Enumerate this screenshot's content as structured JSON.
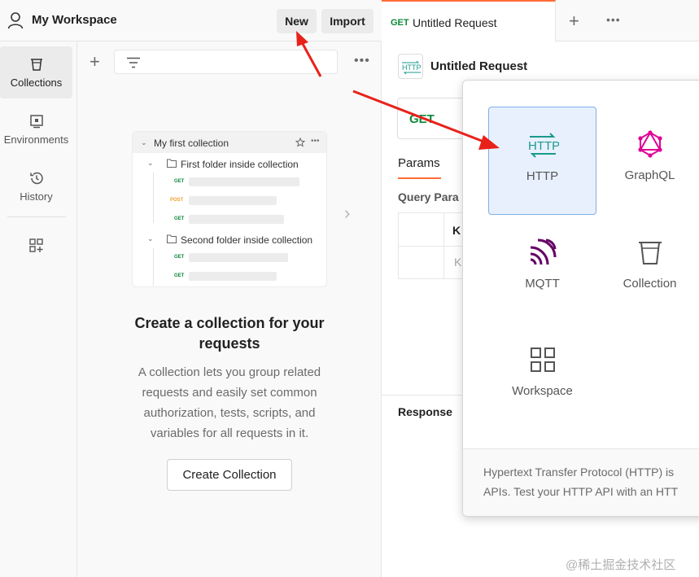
{
  "workspace": {
    "title": "My Workspace",
    "new_label": "New",
    "import_label": "Import"
  },
  "leftnav": {
    "items": [
      {
        "label": "Collections",
        "icon": "trash-bin-icon"
      },
      {
        "label": "Environments",
        "icon": "environment-icon"
      },
      {
        "label": "History",
        "icon": "history-icon"
      }
    ]
  },
  "illustration": {
    "collection_title": "My first collection",
    "folder1": "First folder inside collection",
    "folder2": "Second folder inside collection",
    "methods": [
      "GET",
      "POST",
      "GET",
      "GET",
      "GET"
    ]
  },
  "empty_state": {
    "title": "Create a collection for your requests",
    "description": "A collection lets you group related requests and easily set common authorization, tests, scripts, and variables for all requests in it.",
    "button": "Create Collection"
  },
  "tab": {
    "method": "GET",
    "name": "Untitled Request"
  },
  "request": {
    "title": "Untitled Request",
    "method": "GET",
    "params_tab": "Params",
    "query_params_label": "Query Para",
    "key_header": "K",
    "key_placeholder": "K",
    "response_label": "Response"
  },
  "popup": {
    "tiles": [
      {
        "label": "HTTP",
        "icon": "http-icon"
      },
      {
        "label": "GraphQL",
        "icon": "graphql-icon"
      },
      {
        "label": "MQTT",
        "icon": "mqtt-icon"
      },
      {
        "label": "Collection",
        "icon": "collection-bin-icon"
      },
      {
        "label": "Workspace",
        "icon": "workspace-grid-icon"
      }
    ],
    "footer_line1": "Hypertext Transfer Protocol (HTTP) is",
    "footer_line2": "APIs. Test your HTTP API with an HTT"
  },
  "watermark": "@稀土掘金技术社区",
  "colors": {
    "accent_orange": "#ff6c37",
    "get_green": "#0b8a37",
    "post_orange": "#f0a030",
    "selected_tile_bg": "#e8f0fe",
    "arrow_red": "#e8221b"
  }
}
